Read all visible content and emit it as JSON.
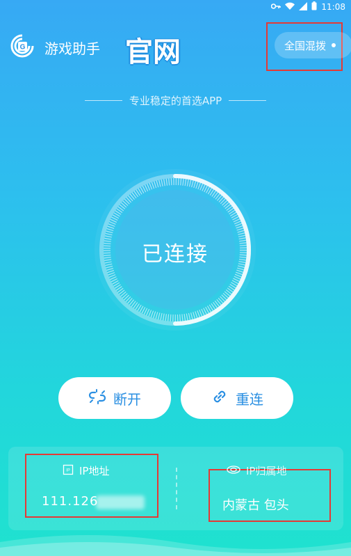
{
  "status_bar": {
    "time": "11:08"
  },
  "header": {
    "brand": "游戏助手",
    "official": "官网",
    "route_button": "全国混拨"
  },
  "tagline": "专业稳定的首选APP",
  "dial": {
    "status": "已连接"
  },
  "actions": {
    "disconnect": "断开",
    "reconnect": "重连"
  },
  "info": {
    "ip_label": "IP地址",
    "ip_value": "111.126",
    "location_label": "IP归属地",
    "location_value": "内蒙古 包头"
  },
  "colors": {
    "accent_blue": "#2a8fe2",
    "highlight_red": "#e53935"
  }
}
